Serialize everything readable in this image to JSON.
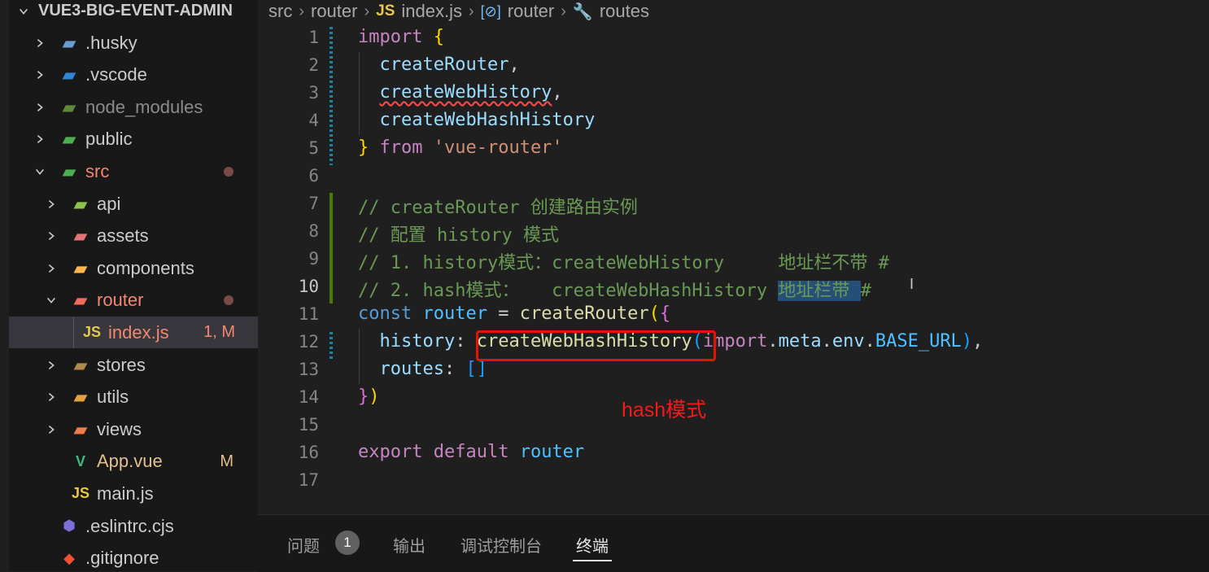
{
  "explorer": {
    "root": "VUE3-BIG-EVENT-ADMIN",
    "items": [
      {
        "name": ".husky",
        "icon": "husky-folder-icon",
        "depth": 0,
        "expanded": false
      },
      {
        "name": ".vscode",
        "icon": "vscode-folder-icon",
        "depth": 0,
        "expanded": false
      },
      {
        "name": "node_modules",
        "icon": "node-folder-icon",
        "depth": 0,
        "expanded": false
      },
      {
        "name": "public",
        "icon": "public-folder-icon",
        "depth": 0,
        "expanded": false
      },
      {
        "name": "src",
        "icon": "src-folder-icon",
        "depth": 0,
        "expanded": true,
        "modified": true
      },
      {
        "name": "api",
        "icon": "api-folder-icon",
        "depth": 1,
        "expanded": false
      },
      {
        "name": "assets",
        "icon": "assets-folder-icon",
        "depth": 1,
        "expanded": false
      },
      {
        "name": "components",
        "icon": "components-folder-icon",
        "depth": 1,
        "expanded": false
      },
      {
        "name": "router",
        "icon": "router-folder-icon",
        "depth": 1,
        "expanded": true,
        "modified": true
      },
      {
        "name": "index.js",
        "icon": "js-file-icon",
        "depth": 2,
        "badge": "1, M",
        "selected": true
      },
      {
        "name": "stores",
        "icon": "folder-icon",
        "depth": 1,
        "expanded": false
      },
      {
        "name": "utils",
        "icon": "utils-folder-icon",
        "depth": 1,
        "expanded": false
      },
      {
        "name": "views",
        "icon": "views-folder-icon",
        "depth": 1,
        "expanded": false
      },
      {
        "name": "App.vue",
        "icon": "vue-file-icon",
        "depth": 1,
        "badge": "M"
      },
      {
        "name": "main.js",
        "icon": "js-file-icon",
        "depth": 1
      },
      {
        "name": ".eslintrc.cjs",
        "icon": "eslint-file-icon",
        "depth": 0
      },
      {
        "name": ".gitignore",
        "icon": "git-file-icon",
        "depth": 0
      }
    ]
  },
  "breadcrumb": {
    "parts": [
      "src",
      "router",
      "index.js",
      "router",
      "routes"
    ],
    "js_label": "JS"
  },
  "editor": {
    "active_line": 10,
    "line_numbers": [
      "1",
      "2",
      "3",
      "4",
      "5",
      "6",
      "7",
      "8",
      "9",
      "10",
      "11",
      "12",
      "13",
      "14",
      "15",
      "16",
      "17"
    ],
    "lines": {
      "l1": [
        "import",
        "{"
      ],
      "l2": [
        "createRouter",
        ","
      ],
      "l3": [
        "createWebHistory",
        ","
      ],
      "l4": [
        "createWebHashHistory"
      ],
      "l5": [
        "}",
        "from",
        "'vue-router'"
      ],
      "l7": "// createRouter 创建路由实例",
      "l8": "// 配置 history 模式",
      "l9a": "// 1. history模式：createWebHistory     ",
      "l9b": "地址栏不带 #",
      "l10a": "// 2. hash模式：   createWebHashHistory ",
      "l10b": "地址栏带 ",
      "l10c": "#",
      "l11": [
        "const",
        "router",
        "=",
        "createRouter",
        "(",
        "{"
      ],
      "l12": [
        "history",
        ":",
        "createWebHashHistory",
        "(",
        "import",
        ".",
        "meta",
        ".",
        "env",
        ".",
        "BASE_URL",
        ")",
        ","
      ],
      "l13": [
        "routes",
        ":",
        "[",
        "]"
      ],
      "l14": [
        "}",
        ")"
      ],
      "l16": [
        "export",
        "default",
        "router"
      ]
    },
    "annotation": "hash模式"
  },
  "panel": {
    "tabs": [
      "问题",
      "输出",
      "调试控制台",
      "终端"
    ],
    "problem_count": "1",
    "active_tab": "终端"
  },
  "colors": {
    "keyword": "#c586c0",
    "function": "#dcdcaa",
    "variable": "#9cdcfe",
    "string": "#ce9178",
    "comment": "#6a9955",
    "annotation": "#f11b1b",
    "highlight_box": "#e51400"
  }
}
